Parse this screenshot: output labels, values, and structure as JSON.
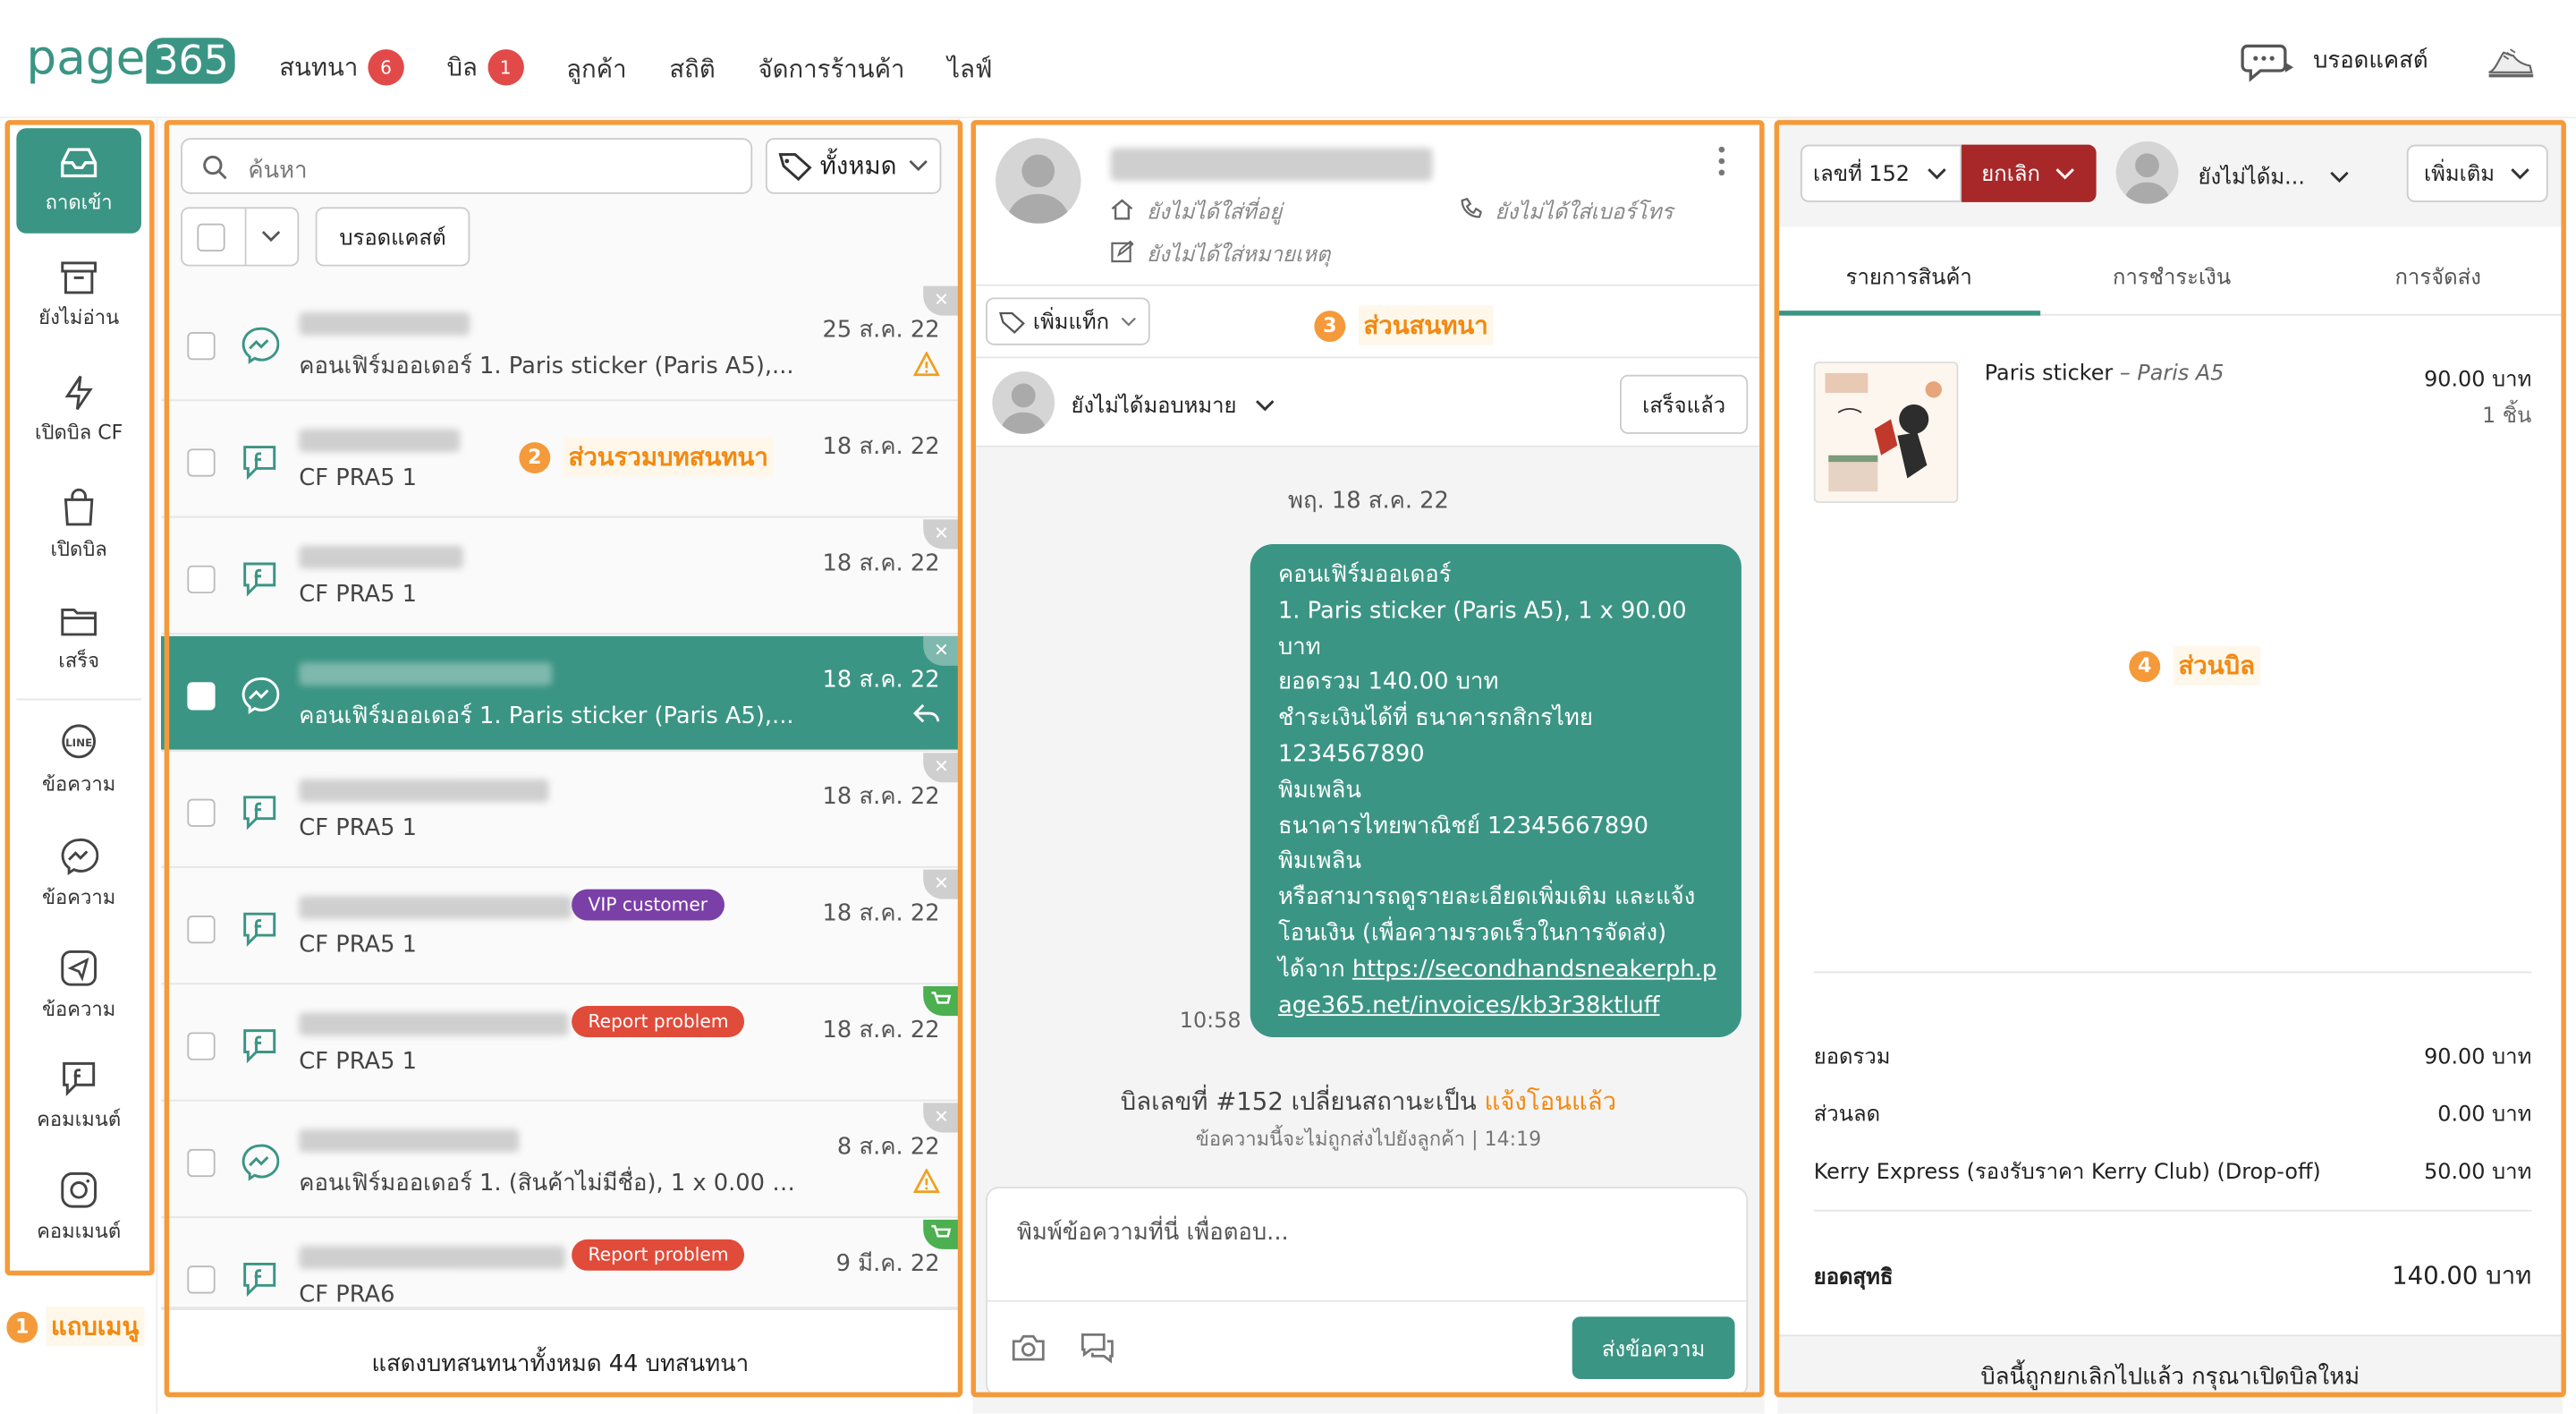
{
  "brand": {
    "logo_word": "page",
    "logo_num": "365"
  },
  "nav": [
    {
      "label": "สนทนา",
      "count": "6"
    },
    {
      "label": "บิล",
      "count": "1"
    },
    {
      "label": "ลูกค้า"
    },
    {
      "label": "สถิติ"
    },
    {
      "label": "จัดการร้านค้า"
    },
    {
      "label": "ไลฟ์"
    }
  ],
  "header": {
    "broadcast_label": "บรอดแคสต์"
  },
  "sidebar": {
    "items": [
      {
        "label": "ถาดเข้า",
        "icon": "inbox-icon"
      },
      {
        "label": "ยังไม่อ่าน",
        "icon": "archive-icon"
      },
      {
        "label": "เปิดบิล CF",
        "icon": "bolt-icon"
      },
      {
        "label": "เปิดบิล",
        "icon": "bag-icon"
      },
      {
        "label": "เสร็จ",
        "icon": "folder-icon"
      },
      {
        "label": "ข้อความ",
        "icon": "line-icon"
      },
      {
        "label": "ข้อความ",
        "icon": "messenger-icon"
      },
      {
        "label": "ข้อความ",
        "icon": "send-icon"
      },
      {
        "label": "คอมเมนต์",
        "icon": "facebook-comment-icon"
      },
      {
        "label": "คอมเมนต์",
        "icon": "instagram-icon"
      }
    ]
  },
  "annotations": {
    "a1": {
      "num": "1",
      "label": "แถบเมนู"
    },
    "a2": {
      "num": "2",
      "label": "ส่วนรวมบทสนทนา"
    },
    "a3": {
      "num": "3",
      "label": "ส่วนสนทนา"
    },
    "a4": {
      "num": "4",
      "label": "ส่วนบิล"
    }
  },
  "list": {
    "search_placeholder": "ค้นหา",
    "filter_label": "ทั้งหมด",
    "broadcast_button": "บรอดแคสต์",
    "footer": "แสดงบทสนทนาทั้งหมด 44 บทสนทนา",
    "rows": [
      {
        "msg": "คอนเฟิร์มออเดอร์ 1. Paris sticker (Paris A5),...",
        "date": "25 ส.ค. 22"
      },
      {
        "msg": "CF PRA5 1",
        "date": "18 ส.ค. 22"
      },
      {
        "msg": "CF PRA5 1",
        "date": "18 ส.ค. 22"
      },
      {
        "msg": "คอนเฟิร์มออเดอร์ 1. Paris sticker (Paris A5),...",
        "date": "18 ส.ค. 22"
      },
      {
        "msg": "CF PRA5 1",
        "date": "18 ส.ค. 22"
      },
      {
        "msg": "CF PRA5 1",
        "date": "18 ส.ค. 22",
        "tag": "VIP customer"
      },
      {
        "msg": "CF PRA5 1",
        "date": "18 ส.ค. 22",
        "tag": "Report problem"
      },
      {
        "msg": "คอนเฟิร์มออเดอร์ 1. (สินค้าไม่มีชื่อ), 1 x 0.00 บ...",
        "date": "8 ส.ค. 22"
      },
      {
        "msg": "CF PRA6",
        "date": "9 มี.ค. 22",
        "tag": "Report problem"
      }
    ]
  },
  "chat": {
    "no_address": "ยังไม่ได้ใส่ที่อยู่",
    "no_phone": "ยังไม่ได้ใส่เบอร์โทร",
    "no_note": "ยังไม่ได้ใส่หมายเหตุ",
    "add_tag": "เพิ่มแท็ก",
    "assign": "ยังไม่ได้มอบหมาย",
    "done_button": "เสร็จแล้ว",
    "date_divider": "พฤ. 18 ส.ค. 22",
    "bubble_lines": [
      "คอนเฟิร์มออเดอร์",
      "1. Paris sticker (Paris A5), 1 x 90.00",
      "บาท",
      "ยอดรวม 140.00 บาท",
      "ชำระเงินได้ที่ ธนาคารกสิกรไทย",
      "1234567890",
      "พิมเพลิน",
      "ธนาคารไทยพาณิชย์ 12345667890",
      "พิมเพลิน",
      "หรือสามารถดูรายละเอียดเพิ่มเติม และแจ้ง",
      "โอนเงิน (เพื่อความรวดเร็วในการจัดส่ง)"
    ],
    "bubble_link_prefix": "ได้จาก ",
    "bubble_link_1": "https://secondhandsneakerph.p",
    "bubble_link_2": "age365.net/invoices/kb3r38ktluff",
    "bubble_time": "10:58",
    "status_prefix": "บิลเลขที่ #152 เปลี่ยนสถานะเป็น ",
    "status_value": "แจ้งโอนแล้ว",
    "status_note": "ข้อความนี้จะไม่ถูกส่งไปยังลูกค้า | 14:19",
    "input_placeholder": "พิมพ์ข้อความที่นี่ เพื่อตอบ...",
    "send_button": "ส่งข้อความ"
  },
  "bill": {
    "number": "เลขที่ 152",
    "cancel": "ยกเลิก",
    "assignee": "ยังไม่ได้ม...",
    "more": "เพิ่มเติม",
    "tabs": [
      "รายการสินค้า",
      "การชำระเงิน",
      "การจัดส่ง"
    ],
    "item": {
      "name": "Paris sticker",
      "variant": "– Paris A5",
      "price": "90.00 บาท",
      "qty": "1 ชิ้น"
    },
    "summary": [
      {
        "label": "ยอดรวม",
        "value": "90.00 บาท"
      },
      {
        "label": "ส่วนลด",
        "value": "0.00 บาท"
      },
      {
        "label": "Kerry Express (รองรับราคา Kerry Club) (Drop-off)",
        "value": "50.00 บาท"
      }
    ],
    "net_label": "ยอดสุทธิ",
    "net_value": "140.00 บาท",
    "footer": "บิลนี้ถูกยกเลิกไปแล้ว กรุณาเปิดบิลใหม่"
  },
  "colors": {
    "accent": "#f59a3b",
    "teal": "#3b9584",
    "cancel": "#a8282a",
    "badge": "#e24a4a"
  }
}
